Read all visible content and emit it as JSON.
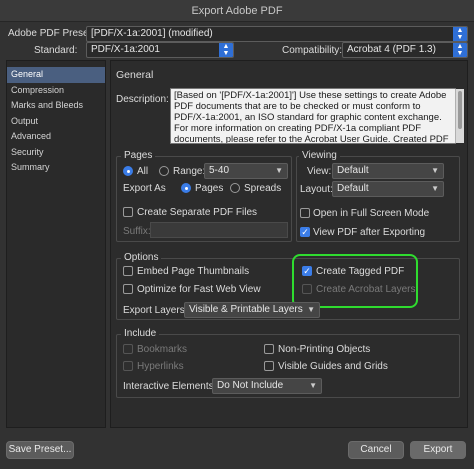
{
  "window": {
    "title": "Export Adobe PDF"
  },
  "top": {
    "preset_label": "Adobe PDF Preset:",
    "preset_value": "[PDF/X-1a:2001] (modified)",
    "standard_label": "Standard:",
    "standard_value": "PDF/X-1a:2001",
    "compat_label": "Compatibility:",
    "compat_value": "Acrobat 4 (PDF 1.3)"
  },
  "sidebar": {
    "items": [
      "General",
      "Compression",
      "Marks and Bleeds",
      "Output",
      "Advanced",
      "Security",
      "Summary"
    ],
    "selected": "General"
  },
  "general": {
    "heading": "General",
    "description_label": "Description:",
    "description_text": "[Based on '[PDF/X-1a:2001]'] Use these settings to create Adobe PDF documents that are to be checked or must conform to PDF/X-1a:2001, an ISO standard for graphic content exchange.  For more information on creating PDF/X-1a compliant PDF documents, please refer to the Acrobat User Guide.  Created PDF documents"
  },
  "pages": {
    "title": "Pages",
    "all_label": "All",
    "range_label": "Range:",
    "range_value": "5-40",
    "export_as_label": "Export As",
    "pages_label": "Pages",
    "spreads_label": "Spreads",
    "separate_label": "Create Separate PDF Files",
    "suffix_label": "Suffix:"
  },
  "viewing": {
    "title": "Viewing",
    "view_label": "View:",
    "view_value": "Default",
    "layout_label": "Layout:",
    "layout_value": "Default",
    "fullscreen_label": "Open in Full Screen Mode",
    "viewafter_label": "View PDF after Exporting"
  },
  "options": {
    "title": "Options",
    "thumbs_label": "Embed Page Thumbnails",
    "fastweb_label": "Optimize for Fast Web View",
    "tagged_label": "Create Tagged PDF",
    "acrolayers_label": "Create Acrobat Layers",
    "layers_label": "Export Layers:",
    "layers_value": "Visible & Printable Layers"
  },
  "include": {
    "title": "Include",
    "bookmarks_label": "Bookmarks",
    "hyperlinks_label": "Hyperlinks",
    "nonprinting_label": "Non-Printing Objects",
    "guides_label": "Visible Guides and Grids",
    "interactive_label": "Interactive Elements:",
    "interactive_value": "Do Not Include"
  },
  "footer": {
    "save_preset": "Save Preset...",
    "cancel": "Cancel",
    "export": "Export"
  },
  "colors": {
    "highlight": "#2fdc2f",
    "accent": "#3b7de8"
  }
}
